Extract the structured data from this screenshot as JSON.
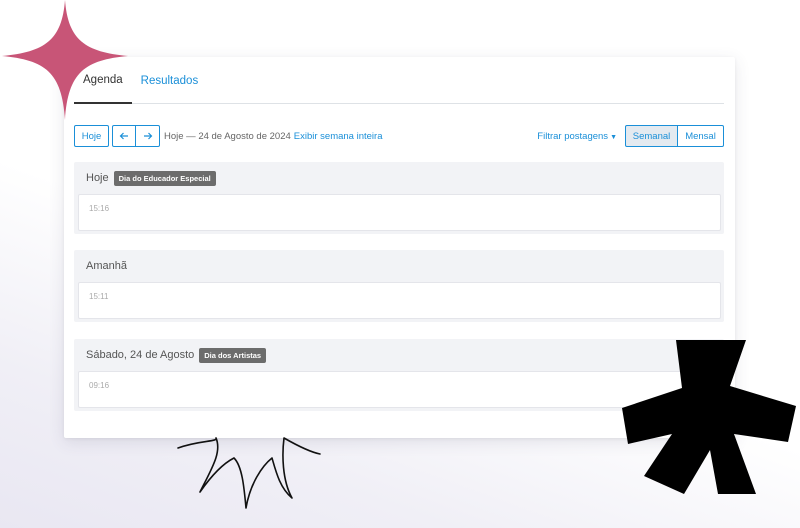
{
  "tabs": [
    {
      "label": "Agenda",
      "active": true
    },
    {
      "label": "Resultados",
      "active": false
    }
  ],
  "toolbar": {
    "today_label": "Hoje",
    "prev_icon": "arrow-left-icon",
    "next_icon": "arrow-right-icon",
    "date_text": "Hoje — 24 de Agosto de 2024",
    "week_link": "Exibir semana inteira",
    "filter_label": "Filtrar postagens",
    "view_weekly": "Semanal",
    "view_monthly": "Mensal",
    "active_view": "Semanal"
  },
  "days": [
    {
      "title": "Hoje",
      "badge": "Dia do Educador Especial",
      "time": "15:16"
    },
    {
      "title": "Amanhã",
      "badge": "",
      "time": "15:11"
    },
    {
      "title": "Sábado, 24 de Agosto",
      "badge": "Dia dos Artistas",
      "time": "09:16"
    }
  ],
  "colors": {
    "accent": "#1a8fd8",
    "sparkle": "#c85577",
    "badge": "#6c6c6c"
  }
}
